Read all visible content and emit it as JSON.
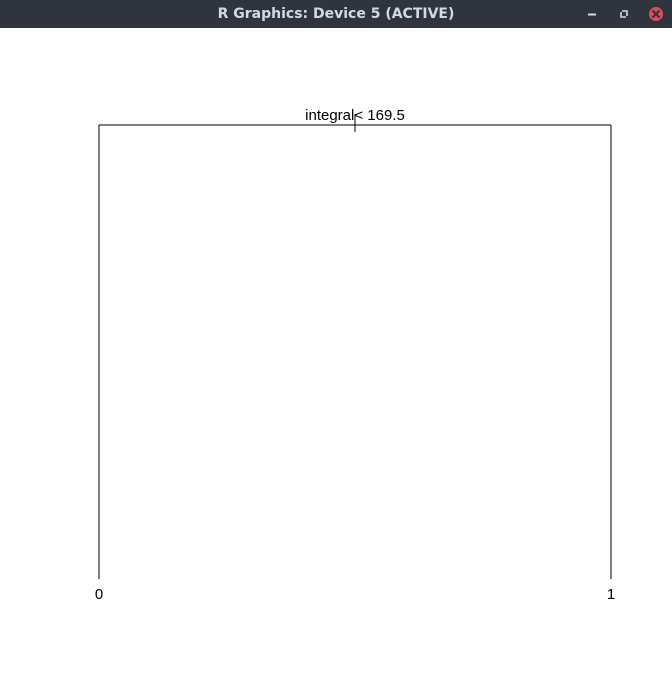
{
  "window": {
    "title": "R Graphics: Device 5 (ACTIVE)",
    "controls": {
      "minimize_icon": "minimize-icon",
      "maximize_icon": "maximize-icon",
      "close_icon": "close-icon"
    },
    "colors": {
      "titlebar": "#2f343f",
      "title_text": "#d3dae3",
      "close": "#e14c5b"
    }
  },
  "plot": {
    "split_label": "integral< 169.5",
    "left_leaf": "0",
    "right_leaf": "1"
  }
}
